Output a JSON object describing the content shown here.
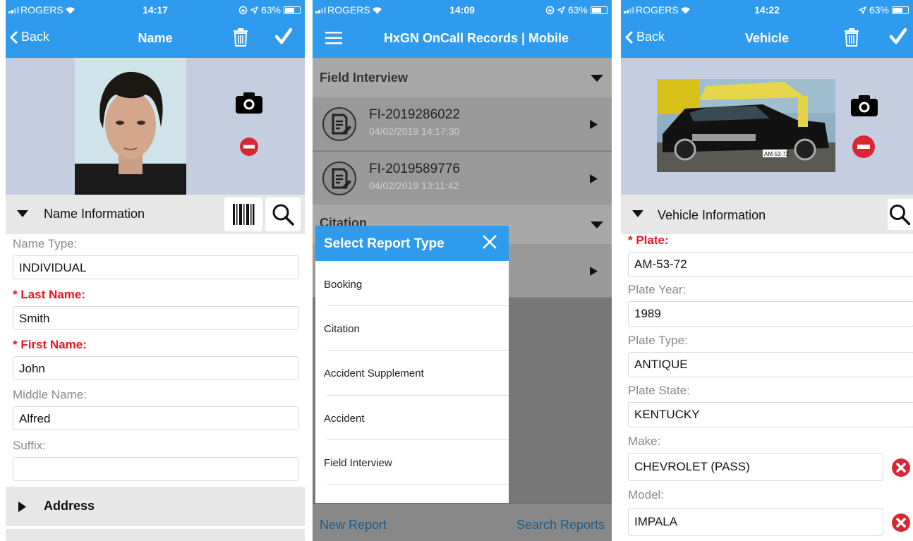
{
  "colors": {
    "accent": "#2f9bef",
    "required": "#e8161d",
    "photo_bg": "#c5cde0",
    "section_bg": "#e7e7e7"
  },
  "panel1": {
    "status": {
      "carrier": "ROGERS",
      "time": "14:17",
      "battery": "63%"
    },
    "nav": {
      "back": "Back",
      "title": "Name"
    },
    "section": "Name Information",
    "fields": [
      {
        "label": "Name Type:",
        "value": "INDIVIDUAL",
        "required": false
      },
      {
        "label": "* Last Name:",
        "value": "Smith",
        "required": true
      },
      {
        "label": "* First Name:",
        "value": "John",
        "required": true
      },
      {
        "label": "Middle Name:",
        "value": "Alfred",
        "required": false
      },
      {
        "label": "Suffix:",
        "value": "",
        "required": false
      }
    ],
    "address": "Address"
  },
  "panel2": {
    "status": {
      "carrier": "ROGERS",
      "time": "14:09",
      "battery": "63%"
    },
    "title": "HxGN OnCall Records | Mobile",
    "section1": "Field Interview",
    "records": [
      {
        "id": "FI-2019286022",
        "time": "04/02/2019 14:17:30"
      },
      {
        "id": "FI-2019589776",
        "time": "04/02/2019 13:11:42"
      }
    ],
    "section2": "Citation",
    "modal": {
      "title": "Select Report Type",
      "items": [
        "Booking",
        "Citation",
        "Accident Supplement",
        "Accident",
        "Field Interview"
      ]
    },
    "bottom": {
      "left": "New Report",
      "right": "Search Reports"
    }
  },
  "panel3": {
    "status": {
      "carrier": "ROGERS",
      "time": "14:22",
      "battery": "63%"
    },
    "nav": {
      "back": "Back",
      "title": "Vehicle"
    },
    "plate_text": "AM-53-72",
    "section": "Vehicle Information",
    "fields": [
      {
        "label": "* Plate:",
        "value": "AM-53-72",
        "required": true
      },
      {
        "label": "Plate Year:",
        "value": "1989",
        "required": false
      },
      {
        "label": "Plate Type:",
        "value": "ANTIQUE",
        "required": false
      },
      {
        "label": "Plate State:",
        "value": "KENTUCKY",
        "required": false
      },
      {
        "label": "Make:",
        "value": "CHEVROLET (PASS)",
        "required": false
      },
      {
        "label": "Model:",
        "value": "IMPALA",
        "required": false
      }
    ]
  }
}
